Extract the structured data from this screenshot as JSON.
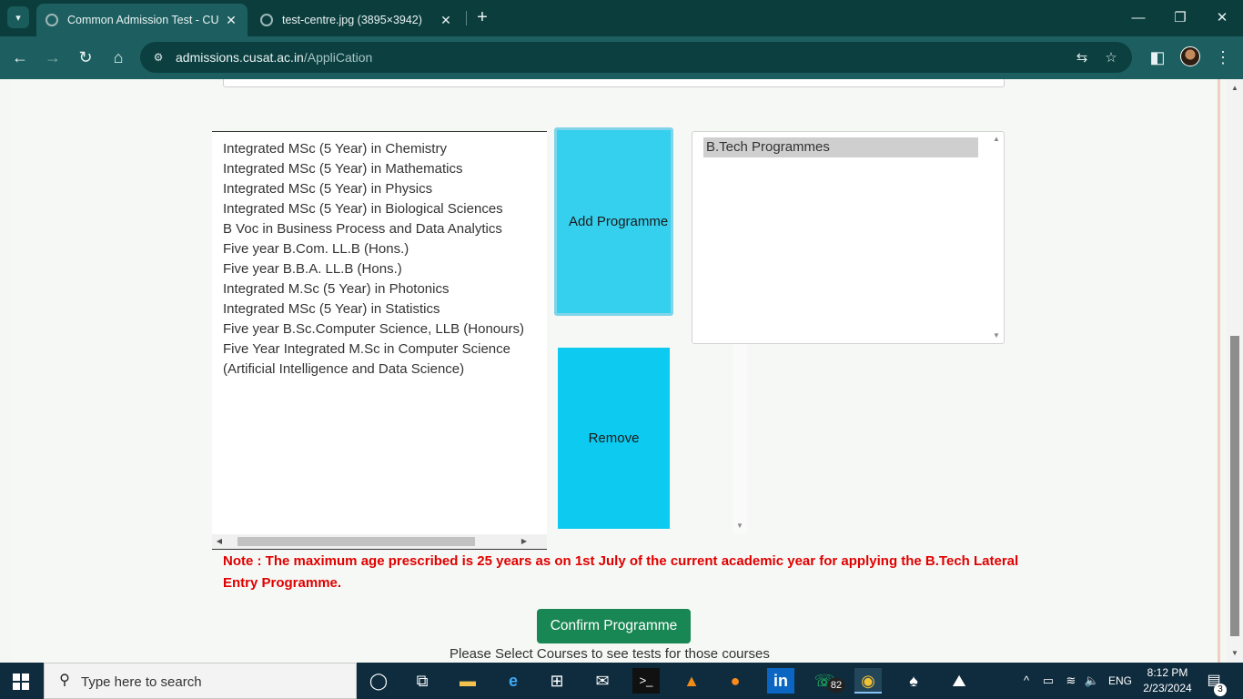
{
  "browser": {
    "tabs": [
      {
        "title": "Common Admission Test - CUSAT",
        "active": true
      },
      {
        "title": "test-centre.jpg (3895×3942)",
        "active": false
      }
    ],
    "url_host": "admissions.cusat.ac.in",
    "url_path": "/AppliCation",
    "icons": {
      "tab_search": "▾",
      "tab_close": "✕",
      "new_tab": "+",
      "minimize": "—",
      "restore": "❐",
      "close": "✕",
      "back": "←",
      "forward": "→",
      "reload": "↻",
      "home": "⌂",
      "site_info": "⚙",
      "translate": "⇆",
      "bookmark": "☆",
      "side_panel": "◧",
      "menu": "⋮"
    }
  },
  "programmes": {
    "available": [
      "Integrated MSc (5 Year) in Chemistry",
      "Integrated MSc (5 Year) in Mathematics",
      "Integrated MSc (5 Year) in Physics",
      "Integrated MSc (5 Year) in Biological Sciences",
      "B Voc in Business Process and Data Analytics",
      "Five year B.Com. LL.B (Hons.)",
      "Five year B.B.A. LL.B (Hons.)",
      "Integrated M.Sc (5 Year) in Photonics",
      "Integrated MSc (5 Year) in Statistics",
      "Five year B.Sc.Computer Science, LLB (Honours)",
      "Five Year Integrated M.Sc in Computer Science (Artificial Intelligence and Data Science)"
    ],
    "selected": [
      "B.Tech Programmes"
    ],
    "add_label": "Add Programme",
    "remove_label": "Remove",
    "note": "Note : The maximum age prescribed is 25 years as on 1st July of the current academic year for applying the B.Tech Lateral Entry Programme.",
    "confirm_label": "Confirm Programme",
    "hint": "Please Select Courses to see tests for those courses"
  },
  "scroll_glyphs": {
    "up": "▲",
    "down": "▼",
    "left": "◀",
    "right": "▶"
  },
  "taskbar": {
    "search_placeholder": "Type here to search",
    "search_icon": "⚲",
    "apps": [
      {
        "name": "cortana-icon",
        "glyph": "◯"
      },
      {
        "name": "task-view-icon",
        "glyph": "⧉"
      },
      {
        "name": "file-explorer-icon",
        "glyph": "▬"
      },
      {
        "name": "edge-icon",
        "glyph": "e"
      },
      {
        "name": "store-icon",
        "glyph": "⊞"
      },
      {
        "name": "mail-icon",
        "glyph": "✉"
      },
      {
        "name": "terminal-icon",
        "glyph": ">_"
      },
      {
        "name": "vlc-icon",
        "glyph": "▲"
      },
      {
        "name": "firefox-icon",
        "glyph": "●"
      },
      {
        "name": "linkedin-icon",
        "glyph": "in"
      },
      {
        "name": "whatsapp-icon",
        "glyph": "☏"
      },
      {
        "name": "chrome-icon",
        "glyph": "◉"
      },
      {
        "name": "solitaire-icon",
        "glyph": "♠"
      },
      {
        "name": "photos-icon",
        "glyph": "⛰"
      }
    ],
    "whatsapp_badge": "82",
    "tray": {
      "chevron": "^",
      "battery": "▭",
      "wifi": "≋",
      "volume": "🔈",
      "language": "ENG"
    },
    "time": "8:12 PM",
    "date": "2/23/2024",
    "notification_glyph": "▤",
    "notification_count": "3"
  },
  "colors": {
    "tab_strip": "#0b3d3d",
    "toolbar": "#1d5f60",
    "add_button": "#35d0ee",
    "remove_button": "#0dcaf0",
    "confirm_button": "#198754",
    "note_text": "#e00000"
  }
}
